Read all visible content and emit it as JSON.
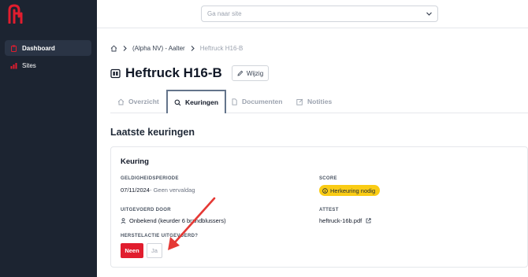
{
  "sidebar": {
    "items": [
      {
        "label": "Dashboard",
        "icon": "clipboard-icon",
        "active": true
      },
      {
        "label": "Sites",
        "icon": "bar-chart-icon",
        "active": false
      }
    ]
  },
  "topbar": {
    "search_placeholder": "Ga naar site"
  },
  "breadcrumb": {
    "parent": "(Alpha NV) - Aalter",
    "current": "Heftruck H16-B"
  },
  "page": {
    "title": "Heftruck H16-B",
    "edit_label": "Wijzig"
  },
  "tabs": [
    {
      "label": "Overzicht",
      "icon": "home-icon"
    },
    {
      "label": "Keuringen",
      "icon": "search-icon",
      "active": true
    },
    {
      "label": "Documenten",
      "icon": "document-icon"
    },
    {
      "label": "Notities",
      "icon": "edit-icon"
    }
  ],
  "section": {
    "title": "Laatste keuringen"
  },
  "card": {
    "title": "Keuring",
    "validity_label": "GELDIGHEIDSPERIODE",
    "validity_date": "07/11/2024",
    "validity_suffix": " - Geen vervaldag",
    "score_label": "SCORE",
    "score_value": "Herkeuring nodig",
    "performed_label": "UITGEVOERD DOOR",
    "performed_value": "Onbekend (keurder 6 brandblussers)",
    "attest_label": "ATTEST",
    "attest_file": "heftruck-16b.pdf",
    "repair_label": "HERSTELACTIE UITGEVOERD?",
    "no_label": "Neen",
    "yes_label": "Ja"
  },
  "colors": {
    "sidebar_bg": "#1c2431",
    "brand_red": "#e11d2e",
    "badge_yellow": "#facc15",
    "arrow_red": "#e53935"
  }
}
